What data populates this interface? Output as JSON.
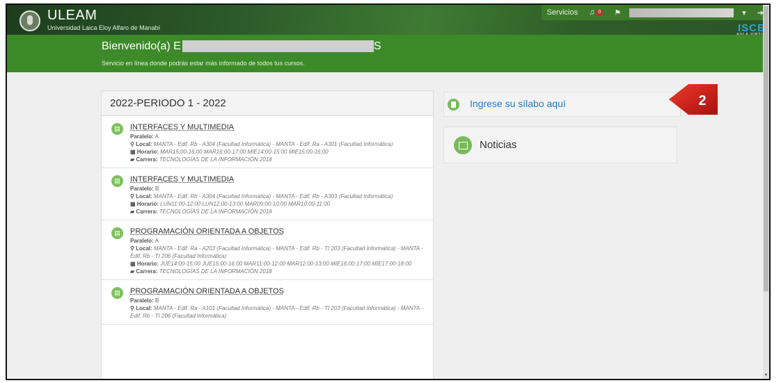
{
  "header": {
    "brand": "ULEAM",
    "brand_sub": "Universidad Laica Eloy Alfaro de Manabí",
    "nav_services": "Servicios",
    "notif_count": "0",
    "logo_text": "ISCE",
    "logo_sub": "AULA VIRTUAL",
    "bg_color": "#2c5a2a"
  },
  "welcome": {
    "title": "Bienvenido(a) E",
    "title_end": "S",
    "subtitle": "Servicio en línea donde podrás estar más informado de todos tus cursos."
  },
  "courses_panel": {
    "heading": "2022-PERIODO 1 - 2022",
    "courses": [
      {
        "title": "INTERFACES Y MULTIMEDIA",
        "paralelo_label": "Paralelo:",
        "paralelo": "A",
        "local_label": "Local:",
        "local": "MANTA - Edif. Rb - A304 (Facultad Informática) - MANTA - Edif. Ra - A301 (Facultad Informática)",
        "horario_label": "Horario:",
        "horario": "MAR15:00-16:00 MAR16:00-17:00 MIE14:00-15:00 MIE15:00-16:00",
        "carrera_label": "Carrera:",
        "carrera": "TECNOLOGÍAS DE LA INFORMACIÓN 2018"
      },
      {
        "title": "INTERFACES Y MULTIMEDIA",
        "paralelo_label": "Paralelo:",
        "paralelo": "B",
        "local_label": "Local:",
        "local": "MANTA - Edif. Rb - A304 (Facultad Informática) - MANTA - Edif. Rb - A303 (Facultad Informática)",
        "horario_label": "Horario:",
        "horario": "LUN11:00-12:00 LUN12:00-13:00 MAR09:00-10:00 MAR10:00-11:00",
        "carrera_label": "Carrera:",
        "carrera": "TECNOLOGÍAS DE LA INFORMACIÓN 2018"
      },
      {
        "title": "PROGRAMACIÓN ORIENTADA A OBJETOS",
        "paralelo_label": "Paralelo:",
        "paralelo": "A",
        "local_label": "Local:",
        "local": "MANTA - Edif. Ra - A203 (Facultad Informática) - MANTA - Edif. Rb - TI 203 (Facultad Informática) - MANTA - Edif. Rb - TI 206 (Facultad Informática)",
        "horario_label": "Horario:",
        "horario": "JUE14:00-15:00 JUE15:00-16:00 MAR11:00-12:00 MAR12:00-13:00 MIE16:00-17:00 MIE17:00-18:00",
        "carrera_label": "Carrera:",
        "carrera": "TECNOLOGÍAS DE LA INFORMACIÓN 2018"
      },
      {
        "title": "PROGRAMACIÓN ORIENTADA A OBJETOS",
        "paralelo_label": "Paralelo:",
        "paralelo": "B",
        "local_label": "Local:",
        "local": "MANTA - Edif. Ra - A101 (Facultad Informática) - MANTA - Edif. Rb - TI 203 (Facultad Informática) - MANTA - Edif. Rb - TI 206 (Facultad Informática)",
        "horario_label": "",
        "horario": "",
        "carrera_label": "",
        "carrera": ""
      }
    ]
  },
  "right": {
    "syllabus": "Ingrese su sílabo aquí",
    "marker": "2",
    "noticias": "Noticias",
    "marker_color": "#cc1111",
    "link_color": "#1f7cc7"
  }
}
